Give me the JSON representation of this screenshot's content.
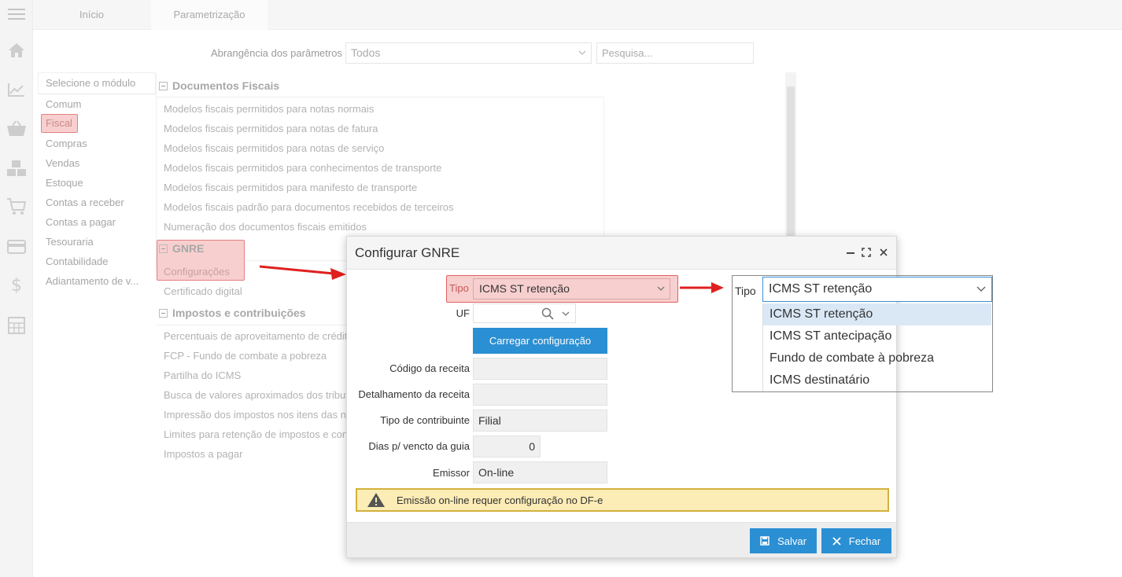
{
  "tabs": [
    {
      "label": "Início"
    },
    {
      "label": "Parametrização"
    }
  ],
  "filter": {
    "label": "Abrangência dos parâmetros",
    "value": "Todos",
    "search_placeholder": "Pesquisa..."
  },
  "modules": {
    "header": "Selecione o módulo",
    "items": [
      "Comum",
      "Fiscal",
      "Compras",
      "Vendas",
      "Estoque",
      "Contas a receber",
      "Contas a pagar",
      "Tesouraria",
      "Contabilidade",
      "Adiantamento de v..."
    ]
  },
  "sections": [
    {
      "title": "Documentos Fiscais",
      "items": [
        "Modelos fiscais permitidos para notas normais",
        "Modelos fiscais permitidos para notas de fatura",
        "Modelos fiscais permitidos para notas de serviço",
        "Modelos fiscais permitidos para conhecimentos de transporte",
        "Modelos fiscais permitidos para manifesto de transporte",
        "Modelos fiscais padrão para documentos recebidos de terceiros",
        "Numeração dos documentos fiscais emitidos"
      ]
    },
    {
      "title": "GNRE",
      "items": [
        "Configurações",
        "Certificado digital"
      ]
    },
    {
      "title": "Impostos e contribuições",
      "items": [
        "Percentuais de aproveitamento de crédito",
        "FCP - Fundo de combate a pobreza",
        "Partilha do ICMS",
        "Busca de valores aproximados dos tributos",
        "Impressão dos impostos nos itens das notas",
        "Limites para retenção de impostos e contribuições",
        "Impostos a pagar"
      ]
    }
  ],
  "dialog": {
    "title": "Configurar GNRE",
    "tipo_label": "Tipo",
    "tipo_value": "ICMS ST retenção",
    "uf_label": "UF",
    "load_button": "Carregar configuração",
    "codigo_label": "Código da receita",
    "codigo_value": "",
    "detalhamento_label": "Detalhamento da receita",
    "detalhamento_value": "",
    "contribuinte_label": "Tipo de contribuinte",
    "contribuinte_value": "Filial",
    "dias_label": "Dias p/ vencto da guia",
    "dias_value": "0",
    "emissor_label": "Emissor",
    "emissor_value": "On-line",
    "warning": "Emissão on-line requer configuração no DF-e",
    "save_button": "Salvar",
    "close_button": "Fechar"
  },
  "dropdown": {
    "label": "Tipo",
    "value": "ICMS ST retenção",
    "options": [
      "ICMS ST retenção",
      "ICMS ST antecipação",
      "Fundo de combate à pobreza",
      "ICMS destinatário"
    ]
  },
  "colors": {
    "accent": "#2b8fd3",
    "highlight_fill": "#f8cfcf",
    "highlight_border": "#e36060",
    "warning_fill": "#fcecb5",
    "arrow": "#e0201f"
  }
}
